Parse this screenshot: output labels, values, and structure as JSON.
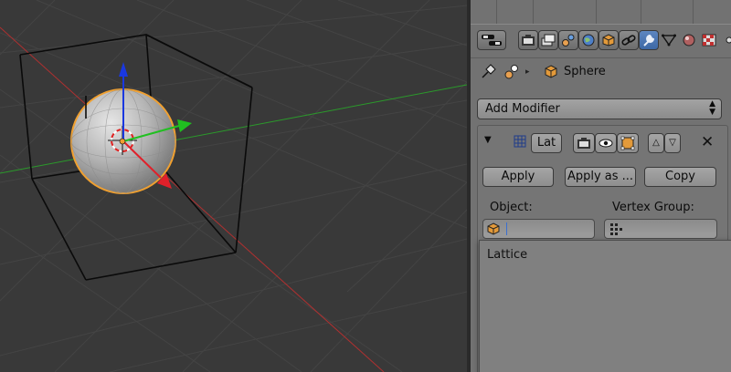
{
  "viewport": {
    "background": "#393939",
    "axes": {
      "x_color": "#c23a3a",
      "y_color": "#2fa52f"
    },
    "selected_object_outline": "#f0a030",
    "gizmo": {
      "x_color": "#e0202a",
      "y_color": "#20c020",
      "z_color": "#1a38e0"
    }
  },
  "properties_panel": {
    "context_tabs": [
      {
        "icon": "render-icon"
      },
      {
        "icon": "render-layers-icon"
      },
      {
        "icon": "scene-icon"
      },
      {
        "icon": "world-icon"
      },
      {
        "icon": "object-icon"
      },
      {
        "icon": "constraints-icon"
      },
      {
        "icon": "modifiers-icon",
        "active": true
      },
      {
        "icon": "object-data-icon"
      },
      {
        "icon": "material-icon"
      },
      {
        "icon": "texture-icon"
      }
    ],
    "breadcrumb": {
      "object_name": "Sphere"
    },
    "add_modifier": {
      "label": "Add Modifier"
    },
    "modifier": {
      "name": "Lat",
      "buttons": {
        "apply": "Apply",
        "apply_as": "Apply as ...",
        "copy": "Copy"
      },
      "object_label": "Object:",
      "object_value": "",
      "vertex_group_label": "Vertex Group:",
      "vertex_group_value": ""
    },
    "object_dropdown": {
      "items": [
        "Lattice"
      ]
    }
  }
}
